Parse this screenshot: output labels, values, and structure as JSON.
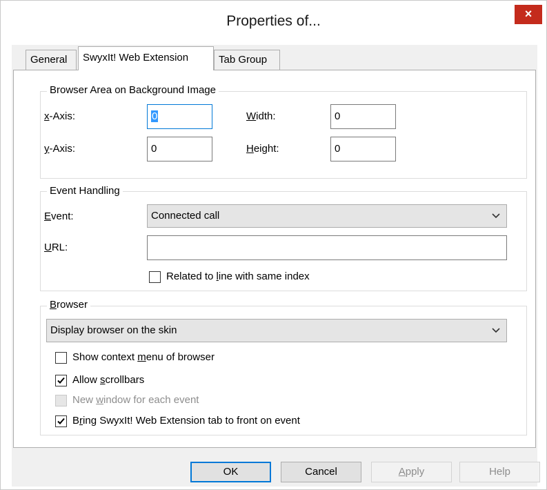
{
  "window": {
    "title": "Properties of...",
    "close_label": "×"
  },
  "tabs": [
    {
      "label": "General",
      "active": false
    },
    {
      "label": "SwyxIt! Web Extension",
      "active": true
    },
    {
      "label": "Tab Group",
      "active": false
    }
  ],
  "browser_area": {
    "title": "Browser Area on Background Image",
    "x_axis": {
      "label_mnemonic": "x",
      "label_rest": "-Axis:",
      "value": "0"
    },
    "y_axis": {
      "label_mnemonic": "y",
      "label_rest": "-Axis:",
      "value": "0"
    },
    "width": {
      "label_mnemonic": "W",
      "label_rest": "idth:",
      "value": "0"
    },
    "height": {
      "label_mnemonic": "H",
      "label_rest": "eight:",
      "value": "0"
    }
  },
  "event_handling": {
    "title": "Event Handling",
    "event_label_mnemonic": "E",
    "event_label_rest": "vent:",
    "event_value": "Connected call",
    "url_label_mnemonic": "U",
    "url_label_rest": "RL:",
    "url_value": "",
    "related_pre": "Related to ",
    "related_mnemonic": "l",
    "related_post": "ine with same index",
    "related_checked": false
  },
  "browser": {
    "title_mnemonic": "B",
    "title_rest": "rowser",
    "mode_value": "Display browser on the skin",
    "options": [
      {
        "pre": "Show context ",
        "mnemonic": "m",
        "post": "enu of browser",
        "checked": false,
        "disabled": false
      },
      {
        "pre": "Allow ",
        "mnemonic": "s",
        "post": "crollbars",
        "checked": true,
        "disabled": false
      },
      {
        "pre": "New ",
        "mnemonic": "w",
        "post": "indow for each event",
        "checked": false,
        "disabled": true
      },
      {
        "pre": "B",
        "mnemonic": "r",
        "post": "ing SwyxIt! Web Extension tab to front on event",
        "checked": true,
        "disabled": false
      }
    ]
  },
  "buttons": {
    "ok": "OK",
    "cancel": "Cancel",
    "apply_mnemonic": "A",
    "apply_rest": "pply",
    "help": "Help"
  },
  "colors": {
    "close_button": "#c42b1c",
    "focus_border": "#0078d7",
    "selection": "#3399ff"
  }
}
